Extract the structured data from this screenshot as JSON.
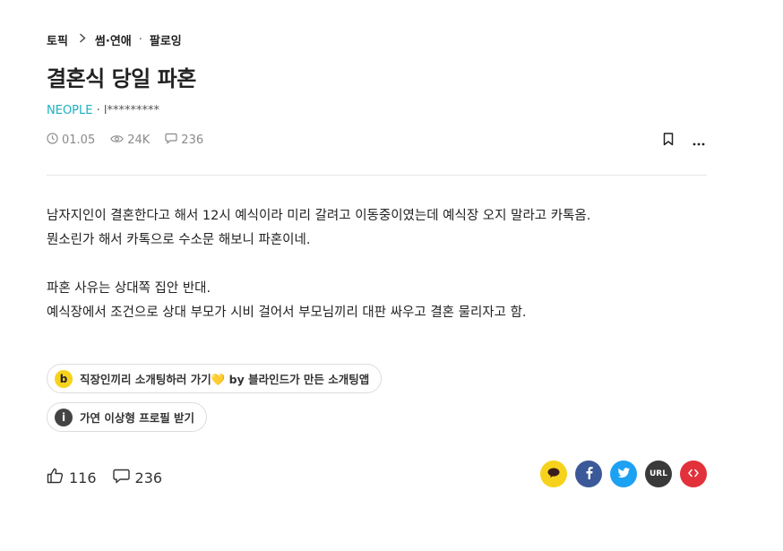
{
  "breadcrumb": {
    "root": "토픽",
    "category": "썸·연애",
    "follow": "팔로잉"
  },
  "post": {
    "title": "결혼식 당일 파혼",
    "company": "NEOPLE",
    "author_sep": " · ",
    "author": "l*********",
    "date": "01.05",
    "views": "24K",
    "comments": "236",
    "body": [
      "남자지인이 결혼한다고 해서 12시 예식이라 미리 갈려고 이동중이였는데 예식장 오지 말라고 카톡옴.",
      "뭔소린가 해서 카톡으로 수소문 해보니 파혼이네.",
      "",
      "파혼 사유는 상대쪽 집안 반대.",
      "예식장에서 조건으로 상대 부모가 시비 걸어서 부모님끼리 대판 싸우고 결혼 물리자고 함."
    ]
  },
  "promos": [
    {
      "badge": "b",
      "label": "직장인끼리 소개팅하러 가기💛 by 블라인드가 만든 소개팅앱"
    },
    {
      "badge": "i",
      "label": "가연 이상형 프로필 받기"
    }
  ],
  "reactions": {
    "likes": "116",
    "comments": "236"
  },
  "share": {
    "url_label": "URL",
    "colors": {
      "kakao": "#f7d21c",
      "facebook": "#3b5998",
      "twitter": "#1da1f2",
      "url": "#3a3a3a",
      "embed": "#e2313a"
    }
  },
  "icons": [
    "clock-icon",
    "eye-icon",
    "comment-icon",
    "bookmark-icon",
    "more-icon",
    "thumbs-up-icon",
    "kakao-icon",
    "facebook-icon",
    "twitter-icon",
    "url-icon",
    "embed-icon"
  ]
}
